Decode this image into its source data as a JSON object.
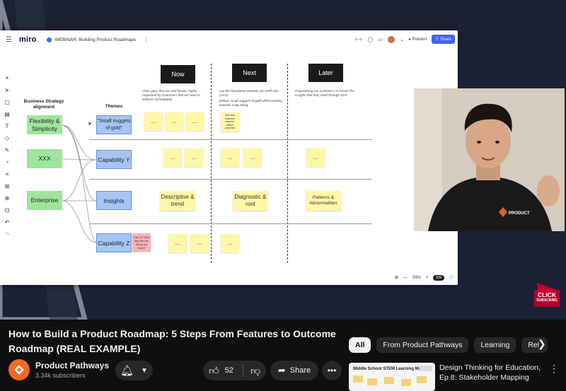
{
  "miro": {
    "logo": "miro",
    "board_title": "WEBINAR: Building Product Roadmaps",
    "present_label": "Present",
    "share_label": "Share",
    "zoom": "34%",
    "page": "5/8",
    "icons": [
      "menu-icon",
      "board-icon",
      "more-icon",
      "reactions-icon",
      "comment-icon",
      "video-icon",
      "avatar-icon",
      "present-icon",
      "share-icon"
    ]
  },
  "board": {
    "columns": [
      {
        "label": "Now",
        "desc": "Clear gaps that are well known, highly requested by customers that we need to address immediately"
      },
      {
        "label": "Next",
        "desc": "Lay the foundation towards our north star (XXX)",
        "desc2": "Deliver small nuggets of gold whilst working towards a big swing"
      },
      {
        "label": "Later",
        "desc": "Empowering our customers to extract the insights that they need through XXX"
      }
    ],
    "alignment_header": "Business Strategy alignment",
    "themes_header": "Themes",
    "alignment": [
      "Flexibility & Simplicity",
      "XXX",
      "Enterprise"
    ],
    "themes": [
      "\"Small nuggets of gold\"",
      "Capability Y",
      "Insights",
      "Capability Z"
    ],
    "ellipsis": "...",
    "small_note": "Will help customer request / deliver purposes",
    "pink_note": "Can (?) very big! Are we doing too much?",
    "descriptive": "Descriptive & trend",
    "diagnostic": "Diagnostic & root",
    "patterns": "Patterns & Abnormalities"
  },
  "badge": {
    "line1": "CLICK",
    "line2": "SUBSCRIBE"
  },
  "video": {
    "title": "How to Build a Product Roadmap: 5 Steps From Features to Outcome Roadmap (REAL EXAMPLE)",
    "channel": "Product Pathways",
    "subscribers": "3.34k subscribers",
    "likes": "52",
    "share_label": "Share"
  },
  "chips": [
    "All",
    "From Product Pathways",
    "Learning",
    "Rel"
  ],
  "recommendation": {
    "title": "Design Thinking for Education, Ep 8: Stakeholder Mapping",
    "thumb_text": "Middle School STEM Learning Map"
  },
  "colors": {
    "miro_blue": "#4262ff",
    "yt_dark": "#0f0f0f",
    "chip_bg": "#272727",
    "channel_orange": "#f26a21",
    "badge_red": "#c4002b"
  }
}
